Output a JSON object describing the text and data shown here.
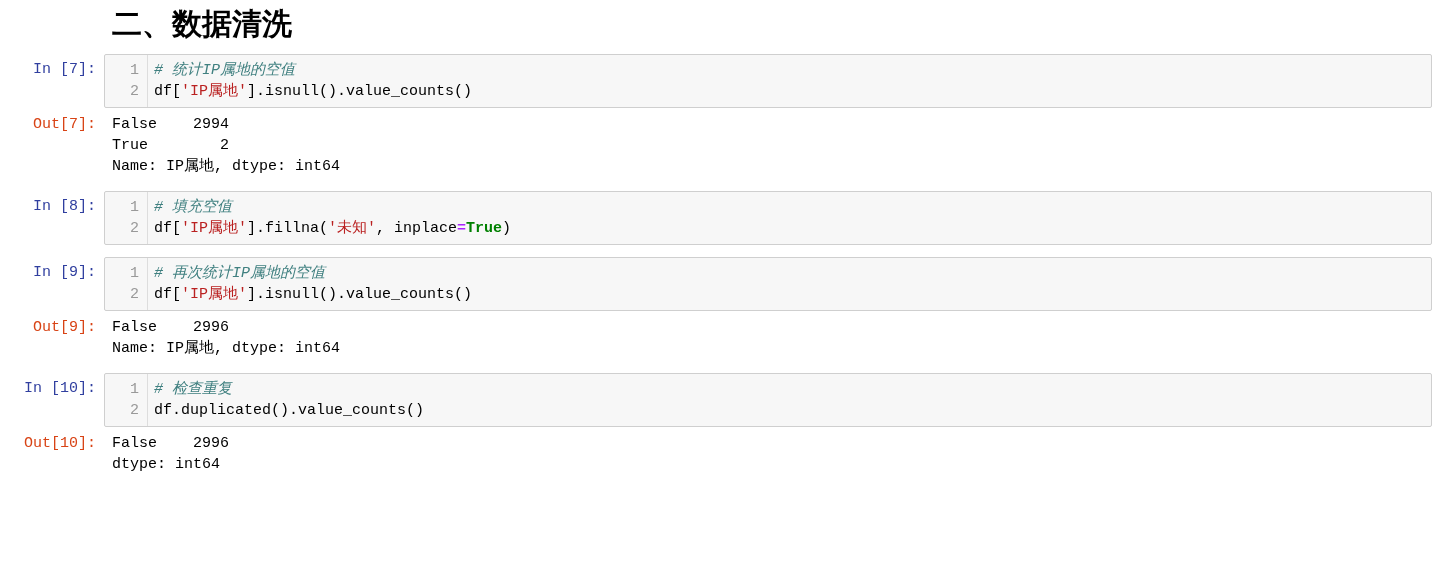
{
  "heading": "二、数据清洗",
  "cells": [
    {
      "input_prompt": "In [7]:",
      "lines": [
        {
          "number": "1",
          "tokens": [
            {
              "kind": "comment",
              "text": "# 统计IP属地的空值"
            }
          ]
        },
        {
          "number": "2",
          "tokens": [
            {
              "kind": "plain",
              "text": "df["
            },
            {
              "kind": "string",
              "text": "'IP属地'"
            },
            {
              "kind": "plain",
              "text": "].isnull().value_counts()"
            }
          ]
        }
      ],
      "output_prompt": "Out[7]:",
      "output": [
        "False    2994",
        "True        2",
        "Name: IP属地, dtype: int64"
      ]
    },
    {
      "input_prompt": "In [8]:",
      "lines": [
        {
          "number": "1",
          "tokens": [
            {
              "kind": "comment",
              "text": "# 填充空值"
            }
          ]
        },
        {
          "number": "2",
          "tokens": [
            {
              "kind": "plain",
              "text": "df["
            },
            {
              "kind": "string",
              "text": "'IP属地'"
            },
            {
              "kind": "plain",
              "text": "].fillna("
            },
            {
              "kind": "string",
              "text": "'未知'"
            },
            {
              "kind": "plain",
              "text": ", inplace"
            },
            {
              "kind": "operator",
              "text": "="
            },
            {
              "kind": "keyword",
              "text": "True"
            },
            {
              "kind": "plain",
              "text": ")"
            }
          ]
        }
      ]
    },
    {
      "input_prompt": "In [9]:",
      "lines": [
        {
          "number": "1",
          "tokens": [
            {
              "kind": "comment",
              "text": "# 再次统计IP属地的空值"
            }
          ]
        },
        {
          "number": "2",
          "tokens": [
            {
              "kind": "plain",
              "text": "df["
            },
            {
              "kind": "string",
              "text": "'IP属地'"
            },
            {
              "kind": "plain",
              "text": "].isnull().value_counts()"
            }
          ]
        }
      ],
      "output_prompt": "Out[9]:",
      "output": [
        "False    2996",
        "Name: IP属地, dtype: int64"
      ]
    },
    {
      "input_prompt": "In [10]:",
      "lines": [
        {
          "number": "1",
          "tokens": [
            {
              "kind": "comment",
              "text": "# 检查重复"
            }
          ]
        },
        {
          "number": "2",
          "tokens": [
            {
              "kind": "plain",
              "text": "df.duplicated().value_counts()"
            }
          ]
        }
      ],
      "output_prompt": "Out[10]:",
      "output": [
        "False    2996",
        "dtype: int64"
      ]
    }
  ]
}
